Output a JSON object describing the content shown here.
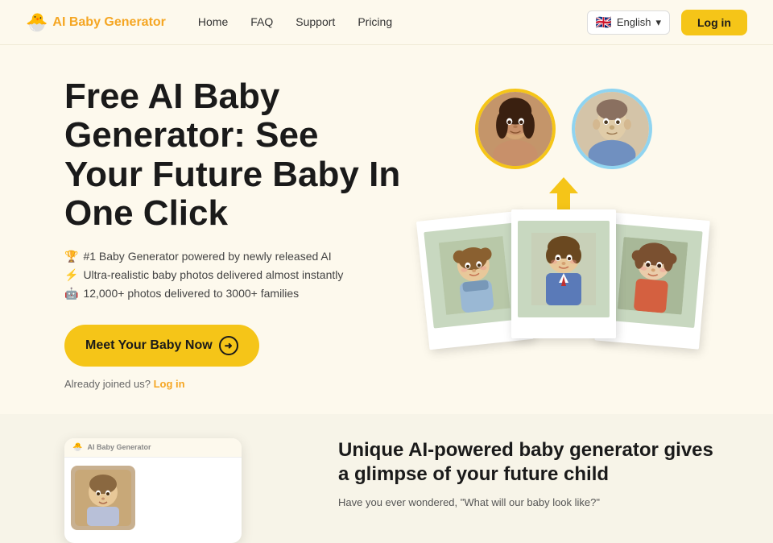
{
  "site": {
    "logo_icon": "🐣",
    "logo_text": "AI Baby Generator",
    "nav_links": [
      "Home",
      "FAQ",
      "Support",
      "Pricing"
    ],
    "lang_flag": "🇬🇧",
    "lang_label": "English",
    "login_label": "Log in"
  },
  "hero": {
    "title": "Free AI Baby Generator: See Your Future Baby In One Click",
    "features": [
      {
        "icon": "🏆",
        "text": "#1 Baby Generator powered by newly released AI"
      },
      {
        "icon": "⚡",
        "text": "Ultra-realistic baby photos delivered almost instantly"
      },
      {
        "icon": "🤖",
        "text": "12,000+ photos delivered to 3000+ families"
      }
    ],
    "cta_label": "Meet Your Baby Now",
    "already_joined": "Already joined us?",
    "login_link": "Log in"
  },
  "section2": {
    "title": "Unique AI-powered baby generator gives a glimpse of your future child",
    "subtitle": "Have you ever wondered, \"What will our baby look like?\"",
    "preview_logo_text": "AI Baby Generator"
  },
  "arrow": "↓"
}
